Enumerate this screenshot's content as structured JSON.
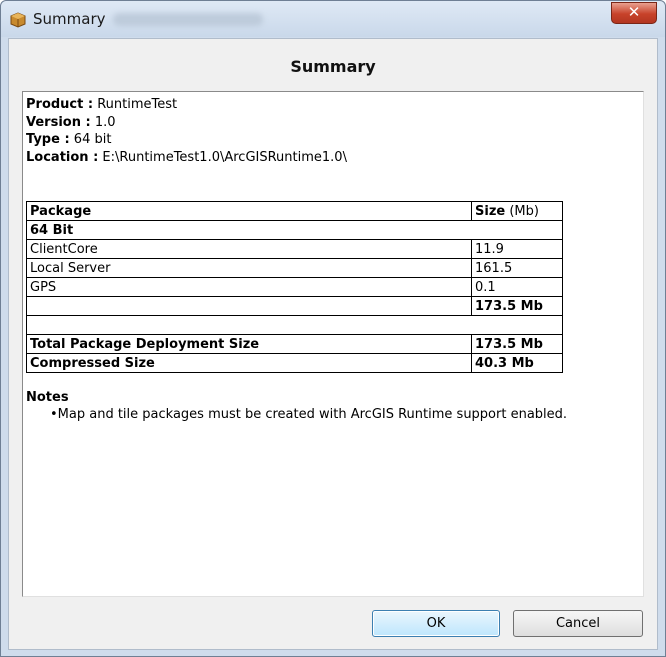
{
  "window": {
    "title": "Summary",
    "close_label": "✕"
  },
  "dialog": {
    "heading": "Summary"
  },
  "info": [
    {
      "label": "Product :",
      "value": "RuntimeTest"
    },
    {
      "label": "Version :",
      "value": "1.0"
    },
    {
      "label": "Type :",
      "value": "64 bit"
    },
    {
      "label": "Location :",
      "value": "E:\\RuntimeTest1.0\\ArcGISRuntime1.0\\"
    }
  ],
  "table": {
    "header_package": "Package",
    "header_size": "Size",
    "header_size_unit": "(Mb)",
    "group": "64 Bit",
    "rows": [
      {
        "name": "ClientCore",
        "size": "11.9"
      },
      {
        "name": "Local Server",
        "size": "161.5"
      },
      {
        "name": "GPS",
        "size": "0.1"
      }
    ],
    "subtotal": "173.5 Mb",
    "total_label": "Total Package Deployment Size",
    "total_value": "173.5 Mb",
    "compressed_label": "Compressed Size",
    "compressed_value": "40.3 Mb"
  },
  "notes": {
    "heading": "Notes",
    "items": [
      "Map and tile packages must be created with ArcGIS Runtime support enabled."
    ]
  },
  "buttons": {
    "ok": "OK",
    "cancel": "Cancel"
  },
  "colors": {
    "titlebar": "#c9d8ea",
    "close": "#c7422a",
    "ok_border": "#3c7fb1"
  }
}
